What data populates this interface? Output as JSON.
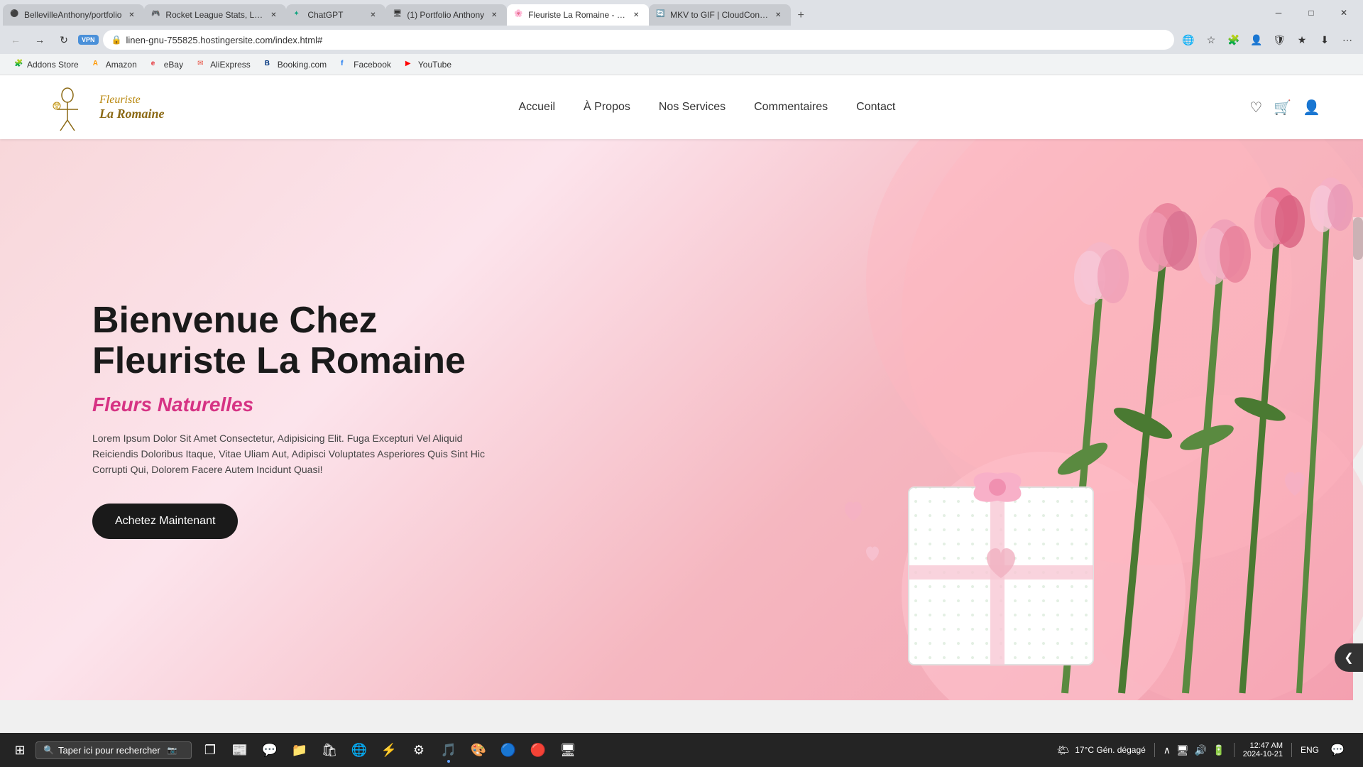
{
  "browser": {
    "tabs": [
      {
        "id": "tab1",
        "favicon": "●",
        "favicon_color": "#888",
        "title": "BellevilleAnthony/portfolio",
        "active": false
      },
      {
        "id": "tab2",
        "favicon": "🎮",
        "title": "Rocket League Stats, Leaderbo...",
        "active": false
      },
      {
        "id": "tab3",
        "favicon": "✦",
        "title": "ChatGPT",
        "active": false
      },
      {
        "id": "tab4",
        "favicon": "🖥",
        "title": "(1) Portfolio Anthony",
        "active": false
      },
      {
        "id": "tab5",
        "favicon": "🌸",
        "title": "Fleuriste La Romaine - Fleuriste...",
        "active": true
      },
      {
        "id": "tab6",
        "favicon": "🔄",
        "title": "MKV to GIF | CloudConvert",
        "active": false
      }
    ],
    "url": "linen-gnu-755825.hostingersite.com/index.html#",
    "vpn_label": "VPN"
  },
  "bookmarks": [
    {
      "id": "bm1",
      "favicon": "🧩",
      "label": "Addons Store"
    },
    {
      "id": "bm2",
      "favicon": "A",
      "label": "Amazon"
    },
    {
      "id": "bm3",
      "favicon": "e",
      "label": "eBay"
    },
    {
      "id": "bm4",
      "favicon": "✉",
      "label": "AliExpress"
    },
    {
      "id": "bm5",
      "favicon": "B",
      "label": "Booking.com"
    },
    {
      "id": "bm6",
      "favicon": "f",
      "label": "Facebook"
    },
    {
      "id": "bm7",
      "favicon": "▶",
      "label": "YouTube"
    }
  ],
  "site": {
    "logo": {
      "line1": "Fleuriste",
      "line2": "La Romaine"
    },
    "nav": {
      "links": [
        {
          "id": "nav1",
          "label": "Accueil"
        },
        {
          "id": "nav2",
          "label": "À Propos"
        },
        {
          "id": "nav3",
          "label": "Nos Services"
        },
        {
          "id": "nav4",
          "label": "Commentaires"
        },
        {
          "id": "nav5",
          "label": "Contact"
        }
      ]
    },
    "hero": {
      "title": "Bienvenue Chez Fleuriste La Romaine",
      "subtitle": "Fleurs Naturelles",
      "description": "Lorem Ipsum Dolor Sit Amet Consectetur, Adipisicing Elit. Fuga Excepturi Vel Aliquid Reiciendis Doloribus Itaque, Vitae Uliam Aut, Adipisci Voluptates Asperiores Quis Sint Hic Corrupti Qui, Dolorem Facere Autem Incidunt Quasi!",
      "cta_label": "Achetez Maintenant"
    }
  },
  "taskbar": {
    "search_placeholder": "Taper ici pour rechercher",
    "weather": "17°C  Gén. dégagé",
    "time": "12:47 AM",
    "date": "2024-10-21",
    "language": "ENG",
    "apps": [
      {
        "id": "start",
        "icon": "⊞"
      },
      {
        "id": "search",
        "icon": "🔍"
      },
      {
        "id": "taskview",
        "icon": "❐"
      },
      {
        "id": "widgets",
        "icon": "🗞"
      },
      {
        "id": "teams",
        "icon": "💬"
      },
      {
        "id": "fileexplorer",
        "icon": "📁"
      },
      {
        "id": "store",
        "icon": "🛍"
      },
      {
        "id": "browser1",
        "icon": "🌐"
      },
      {
        "id": "terminal",
        "icon": "⚡"
      },
      {
        "id": "gear",
        "icon": "⚙"
      },
      {
        "id": "spotify",
        "icon": "🎵"
      },
      {
        "id": "figma",
        "icon": "🎨"
      },
      {
        "id": "chrome",
        "icon": "🔵"
      },
      {
        "id": "opera",
        "icon": "🔴"
      },
      {
        "id": "dev",
        "icon": "🖥"
      }
    ]
  }
}
